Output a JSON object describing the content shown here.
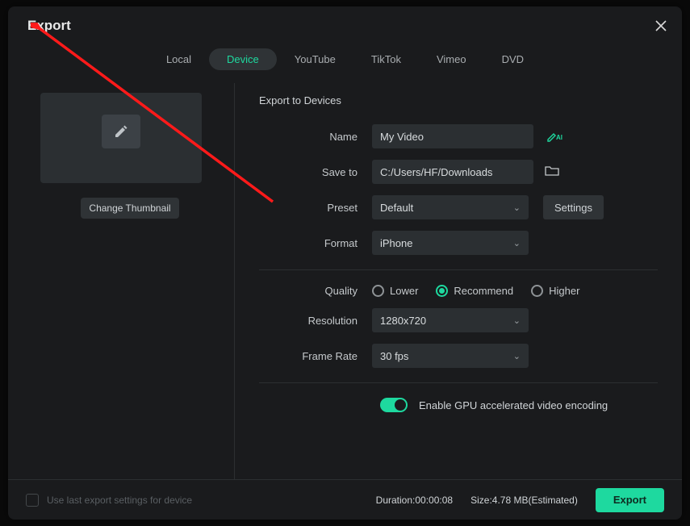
{
  "title": "Export",
  "tabs": [
    "Local",
    "Device",
    "YouTube",
    "TikTok",
    "Vimeo",
    "DVD"
  ],
  "active_tab_index": 1,
  "thumbnail": {
    "change_label": "Change Thumbnail"
  },
  "section_title": "Export to Devices",
  "fields": {
    "name_label": "Name",
    "name_value": "My Video",
    "save_label": "Save to",
    "save_value": "C:/Users/HF/Downloads",
    "preset_label": "Preset",
    "preset_value": "Default",
    "settings_label": "Settings",
    "format_label": "Format",
    "format_value": "iPhone",
    "quality_label": "Quality",
    "quality_options": [
      "Lower",
      "Recommend",
      "Higher"
    ],
    "quality_selected_index": 1,
    "resolution_label": "Resolution",
    "resolution_value": "1280x720",
    "framerate_label": "Frame Rate",
    "framerate_value": "30 fps"
  },
  "gpu_toggle_label": "Enable GPU accelerated video encoding",
  "gpu_toggle_on": true,
  "footer": {
    "use_last_label": "Use last export settings for device",
    "duration_label": "Duration:",
    "duration_value": "00:00:08",
    "size_label": "Size:",
    "size_value": "4.78 MB(Estimated)",
    "export_label": "Export"
  }
}
